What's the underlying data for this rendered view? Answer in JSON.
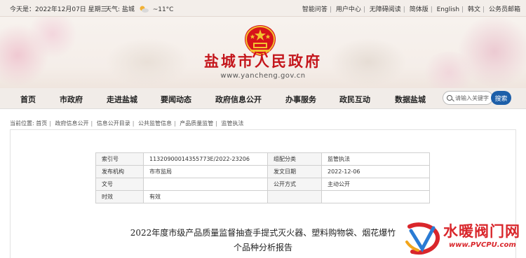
{
  "topbar": {
    "date": "今天是：2022年12月07日 星期三",
    "weather_label": "天气:",
    "weather_city": "盐城",
    "weather_temp": "~11°C",
    "links": [
      "智能问答",
      "用户中心",
      "无障碍阅读",
      "简体版",
      "English",
      "韩文",
      "公务员邮箱"
    ]
  },
  "header": {
    "site_title": "盐城市人民政府",
    "site_url": "www.yancheng.gov.cn"
  },
  "nav": {
    "items": [
      "首页",
      "市政府",
      "走进盐城",
      "要闻动态",
      "政府信息公开",
      "办事服务",
      "政民互动",
      "数据盐城"
    ],
    "search_placeholder": "请输入关键字",
    "search_button": "搜索"
  },
  "breadcrumb": {
    "label": "当前位置:",
    "items": [
      "首页",
      "政府信息公开",
      "信息公开目录",
      "公共监管信息",
      "产品质量监管",
      "监管执法"
    ]
  },
  "meta": {
    "index_label": "索引号",
    "index_value": "11320900014355773E/2022-23206",
    "category_label": "组配分类",
    "category_value": "监管执法",
    "publisher_label": "发布机构",
    "publisher_value": "市市监局",
    "date_label": "发文日期",
    "date_value": "2022-12-06",
    "docno_label": "文号",
    "docno_value": "",
    "disclosure_label": "公开方式",
    "disclosure_value": "主动公开",
    "validity_label": "时效",
    "validity_value": "有效"
  },
  "document": {
    "title_line1": "2022年度市级产品质量监督抽查手提式灭火器、塑料购物袋、烟花爆竹",
    "title_line2": "个品种分析报告"
  },
  "watermark": {
    "cn": "水暖阀门网",
    "en": "www.PVCPU.com"
  },
  "colors": {
    "brand_red": "#c4161c",
    "search_blue": "#1d5fa9"
  }
}
